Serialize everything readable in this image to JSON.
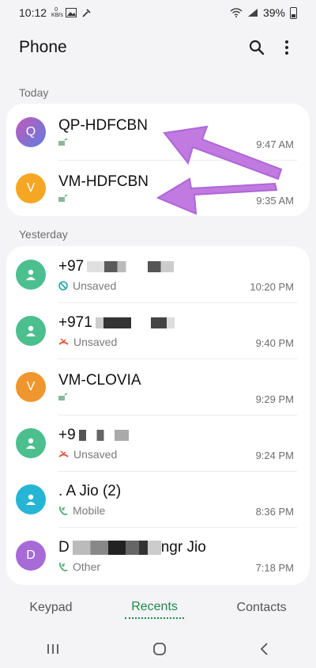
{
  "status": {
    "time": "10:12",
    "speed_top": "0",
    "speed_unit": "KB/s",
    "battery": "39%"
  },
  "app": {
    "title": "Phone"
  },
  "sections": {
    "today": "Today",
    "yesterday": "Yesterday"
  },
  "today": [
    {
      "initial": "Q",
      "name": "QP-HDFCBN",
      "sub": "",
      "time": "9:47 AM",
      "color": "#8e6dd8"
    },
    {
      "initial": "V",
      "name": "VM-HDFCBN",
      "sub": "",
      "time": "9:35 AM",
      "color": "#f5a623"
    }
  ],
  "yesterday": [
    {
      "name": "+97",
      "sub": "Unsaved",
      "time": "10:20 PM",
      "color": "#4cbf8e",
      "sub_icon": "blocked-icon"
    },
    {
      "name": "+971",
      "sub": "Unsaved",
      "time": "9:40 PM",
      "color": "#4cbf8e",
      "sub_icon": "missed-call-icon"
    },
    {
      "initial": "V",
      "name": "VM-CLOVIA",
      "sub": "",
      "time": "9:29 PM",
      "color": "#f5a623",
      "sub_icon": "message-icon"
    },
    {
      "name": "+9",
      "sub": "Unsaved",
      "time": "9:24 PM",
      "color": "#4cbf8e",
      "sub_icon": "missed-call-icon"
    },
    {
      "name": ". A Jio (2)",
      "sub": "Mobile",
      "time": "8:36 PM",
      "color": "#26b5d4",
      "sub_icon": "incoming-call-icon"
    },
    {
      "initial": "D",
      "name": "D",
      "name_tail": "ngr Jio",
      "sub": "Other",
      "time": "7:18 PM",
      "color": "#a66bd6",
      "sub_icon": "incoming-call-icon"
    }
  ],
  "tabs": {
    "keypad": "Keypad",
    "recents": "Recents",
    "contacts": "Contacts"
  },
  "colors": {
    "accent": "#1a8a4c",
    "arrow": "#c07ae0"
  }
}
